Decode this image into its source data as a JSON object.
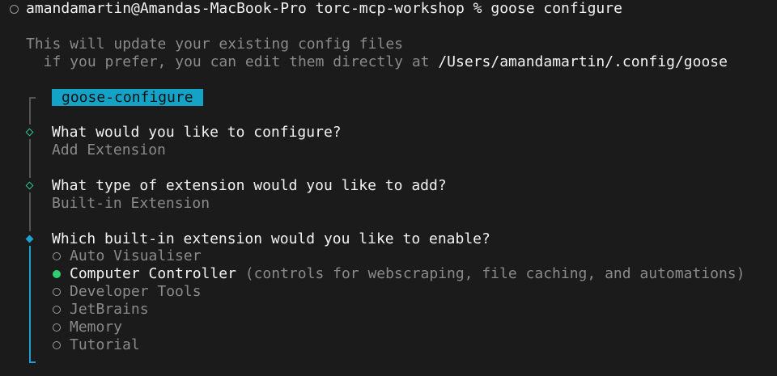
{
  "command": {
    "text": "amandamartin@Amandas-MacBook-Pro torc-mcp-workshop % goose configure"
  },
  "intro": {
    "line1": "This will update your existing config files",
    "line2_prefix": "  if you prefer, you can edit them directly at ",
    "config_path": "/Users/amandamartin/.config/goose"
  },
  "badge": "goose-configure",
  "steps": [
    {
      "question": "What would you like to configure?",
      "answer": "Add Extension"
    },
    {
      "question": "What type of extension would you like to add?",
      "answer": "Built-in Extension"
    },
    {
      "question": "Which built-in extension would you like to enable?"
    }
  ],
  "options": [
    {
      "label": "Auto Visualiser",
      "selected": false
    },
    {
      "label": "Computer Controller",
      "selected": true,
      "hint": "(controls for webscraping, file caching, and automations)"
    },
    {
      "label": "Developer Tools",
      "selected": false
    },
    {
      "label": "JetBrains",
      "selected": false
    },
    {
      "label": "Memory",
      "selected": false
    },
    {
      "label": "Tutorial",
      "selected": false
    }
  ],
  "colors": {
    "accent": "#1e9fd0",
    "badge_bg": "#14a3c7",
    "selected": "#2fce6f",
    "done_marker": "#32c48d",
    "background": "#1b1b1b"
  }
}
